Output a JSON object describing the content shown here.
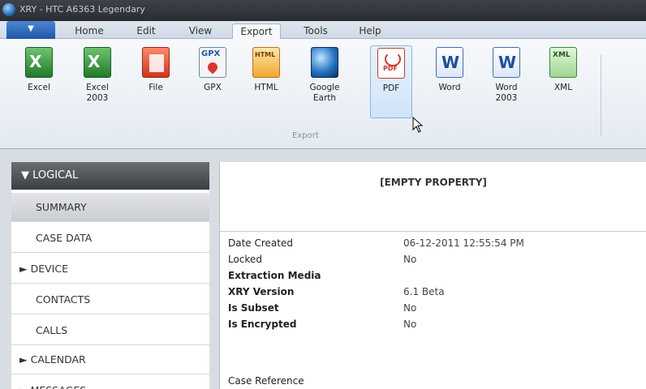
{
  "window": {
    "title": "XRY - HTC A6363 Legendary"
  },
  "file_button": {
    "label": ""
  },
  "tabs": [
    {
      "label": "Home"
    },
    {
      "label": "Edit"
    },
    {
      "label": "View"
    },
    {
      "label": "Export"
    },
    {
      "label": "Tools"
    },
    {
      "label": "Help"
    }
  ],
  "ribbon": {
    "group_label": "Export",
    "buttons": [
      {
        "label": "Excel",
        "icon": "excel-icon"
      },
      {
        "label": "Excel\n2003",
        "icon": "excel-icon"
      },
      {
        "label": "File",
        "icon": "file-icon"
      },
      {
        "label": "GPX",
        "icon": "gpx-icon"
      },
      {
        "label": "HTML",
        "icon": "html-icon"
      },
      {
        "label": "Google\nEarth",
        "icon": "google-earth-icon"
      },
      {
        "label": "PDF",
        "icon": "pdf-icon"
      },
      {
        "label": "Word",
        "icon": "word-icon"
      },
      {
        "label": "Word\n2003",
        "icon": "word-icon"
      },
      {
        "label": "XML",
        "icon": "xml-icon"
      }
    ]
  },
  "sidebar": {
    "header": "▼ LOGICAL",
    "items": [
      {
        "label": "SUMMARY"
      },
      {
        "label": "CASE DATA"
      },
      {
        "label": "► DEVICE"
      },
      {
        "label": "CONTACTS"
      },
      {
        "label": "CALLS"
      },
      {
        "label": "► CALENDAR"
      },
      {
        "label": "► MESSAGES"
      }
    ]
  },
  "panel": {
    "title": "[EMPTY PROPERTY]",
    "properties": [
      {
        "label": "Date Created",
        "value": "06-12-2011 12:55:54 PM"
      },
      {
        "label": "Locked",
        "value": "No"
      },
      {
        "label": "Extraction Media",
        "value": ""
      },
      {
        "label": "XRY Version",
        "value": "6.1 Beta"
      },
      {
        "label": "Is Subset",
        "value": "No"
      },
      {
        "label": "Is Encrypted",
        "value": "No"
      },
      {
        "label": "Case Reference",
        "value": ""
      }
    ]
  }
}
